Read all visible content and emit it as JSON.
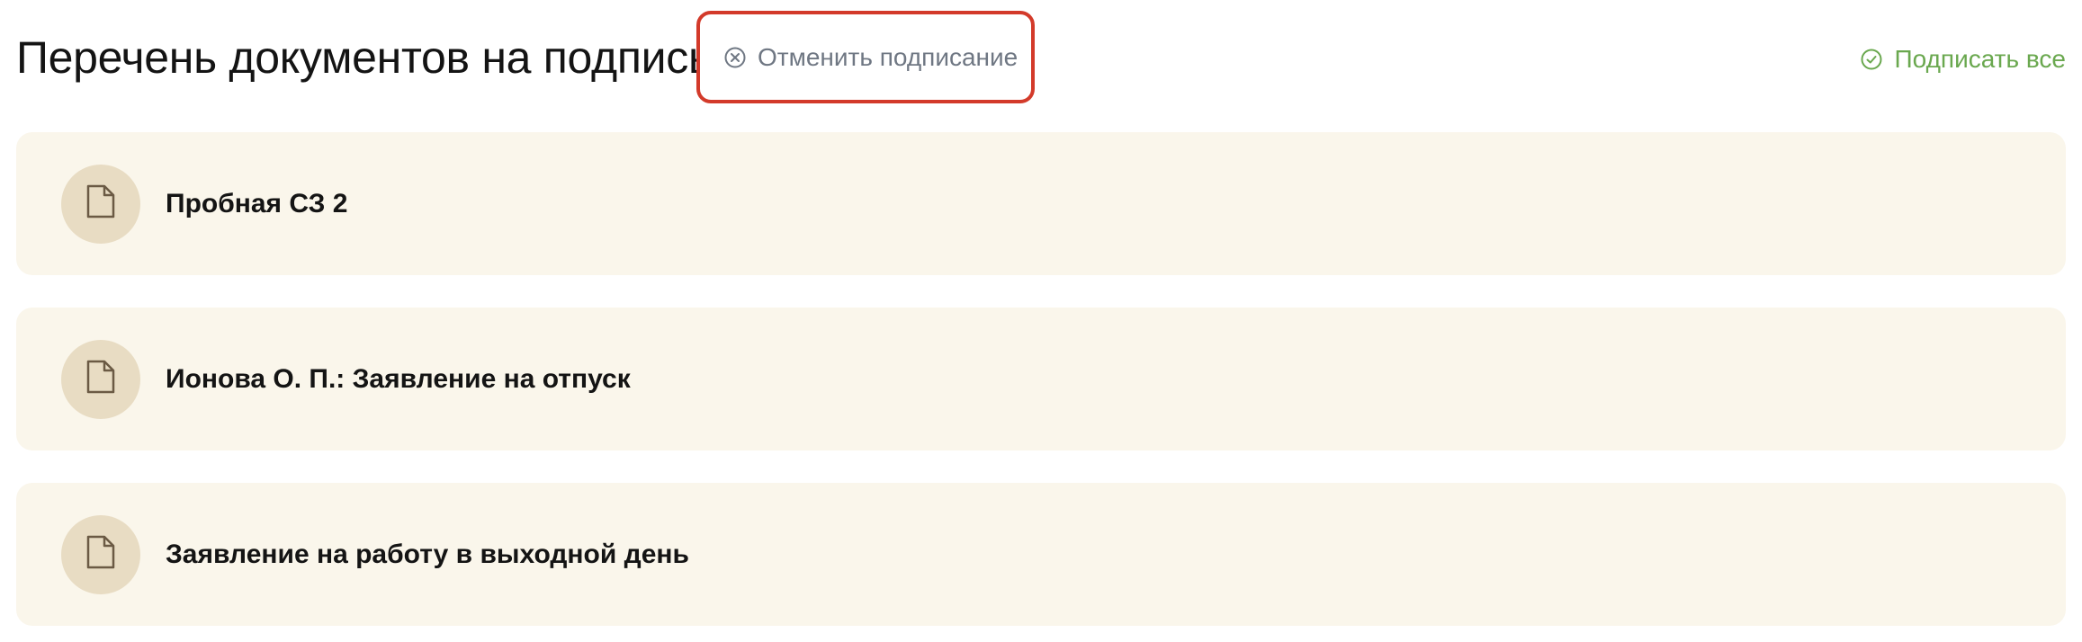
{
  "header": {
    "title": "Перечень документов на подпись",
    "cancel_label": "Отменить подписание",
    "cancel_icon": "x-circle-icon",
    "sign_all_label": "Подписать все",
    "sign_all_icon": "check-circle-icon"
  },
  "documents": [
    {
      "title": "Пробная СЗ 2",
      "icon": "document-icon"
    },
    {
      "title": "Ионова О. П.: Заявление на отпуск",
      "icon": "document-icon"
    },
    {
      "title": "Заявление на работу в выходной день",
      "icon": "document-icon"
    }
  ],
  "colors": {
    "card_background": "#faf6eb",
    "icon_circle": "#e8dcc3",
    "icon_stroke": "#6b5a44",
    "highlight_border": "#d33a2a",
    "sign_all": "#6aa84f",
    "cancel_text": "#6f7783"
  }
}
